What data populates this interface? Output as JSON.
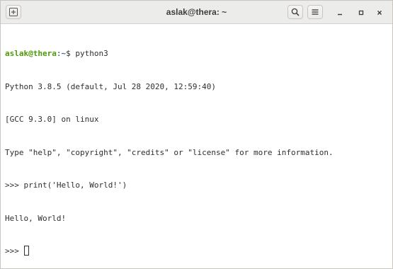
{
  "window": {
    "title": "aslak@thera: ~"
  },
  "icons": {
    "new_tab": "new-tab-icon",
    "search": "search-icon",
    "menu": "hamburger-menu-icon",
    "minimize": "minimize-icon",
    "maximize": "maximize-icon",
    "close": "close-icon"
  },
  "colors": {
    "prompt_user": "#4e9a06",
    "prompt_path": "#3465a4",
    "text": "#2e2e2e",
    "background": "#ffffff",
    "titlebar": "#ececeb"
  },
  "terminal": {
    "prompt": {
      "user_host": "aslak@thera",
      "separator": ":",
      "path": "~",
      "symbol": "$ ",
      "command": "python3"
    },
    "output": [
      "Python 3.8.5 (default, Jul 28 2020, 12:59:40)",
      "[GCC 9.3.0] on linux",
      "Type \"help\", \"copyright\", \"credits\" or \"license\" for more information.",
      ">>> print('Hello, World!')",
      "Hello, World!"
    ],
    "repl_prompt": ">>> "
  }
}
